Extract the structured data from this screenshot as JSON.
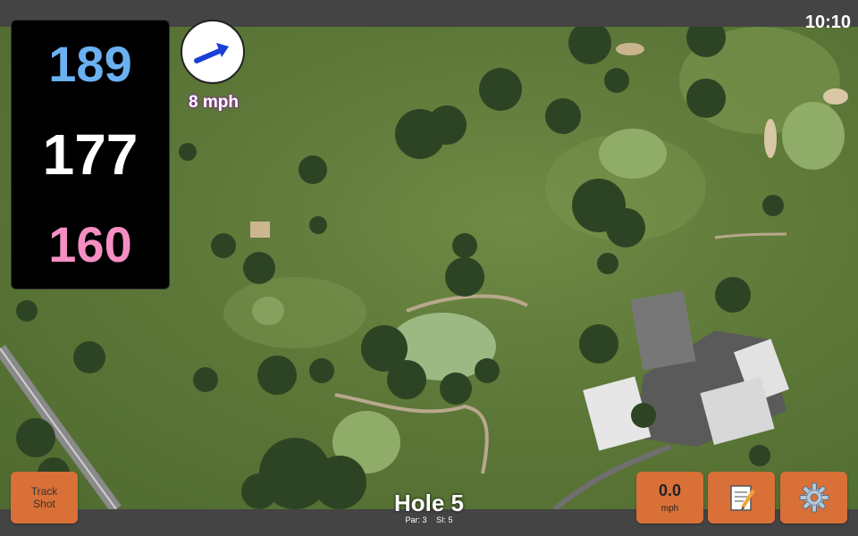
{
  "status": {
    "clock": "10:10"
  },
  "distances": {
    "back": "189",
    "middle": "177",
    "front": "160"
  },
  "wind": {
    "speed": "8 mph",
    "icon": "wind-direction-arrow-icon",
    "color": "#1a3fd6"
  },
  "hole": {
    "title": "Hole 5",
    "par": "Par: 3",
    "stroke_index": "SI: 5"
  },
  "buttons": {
    "track_shot": "Track Shot",
    "speed_value": "0.0",
    "speed_unit": "mph",
    "notes_icon": "notepad-icon",
    "settings_icon": "gear-icon"
  },
  "colors": {
    "button": "#d87038",
    "back": "#6ab1f2",
    "front": "#f58fc3"
  }
}
